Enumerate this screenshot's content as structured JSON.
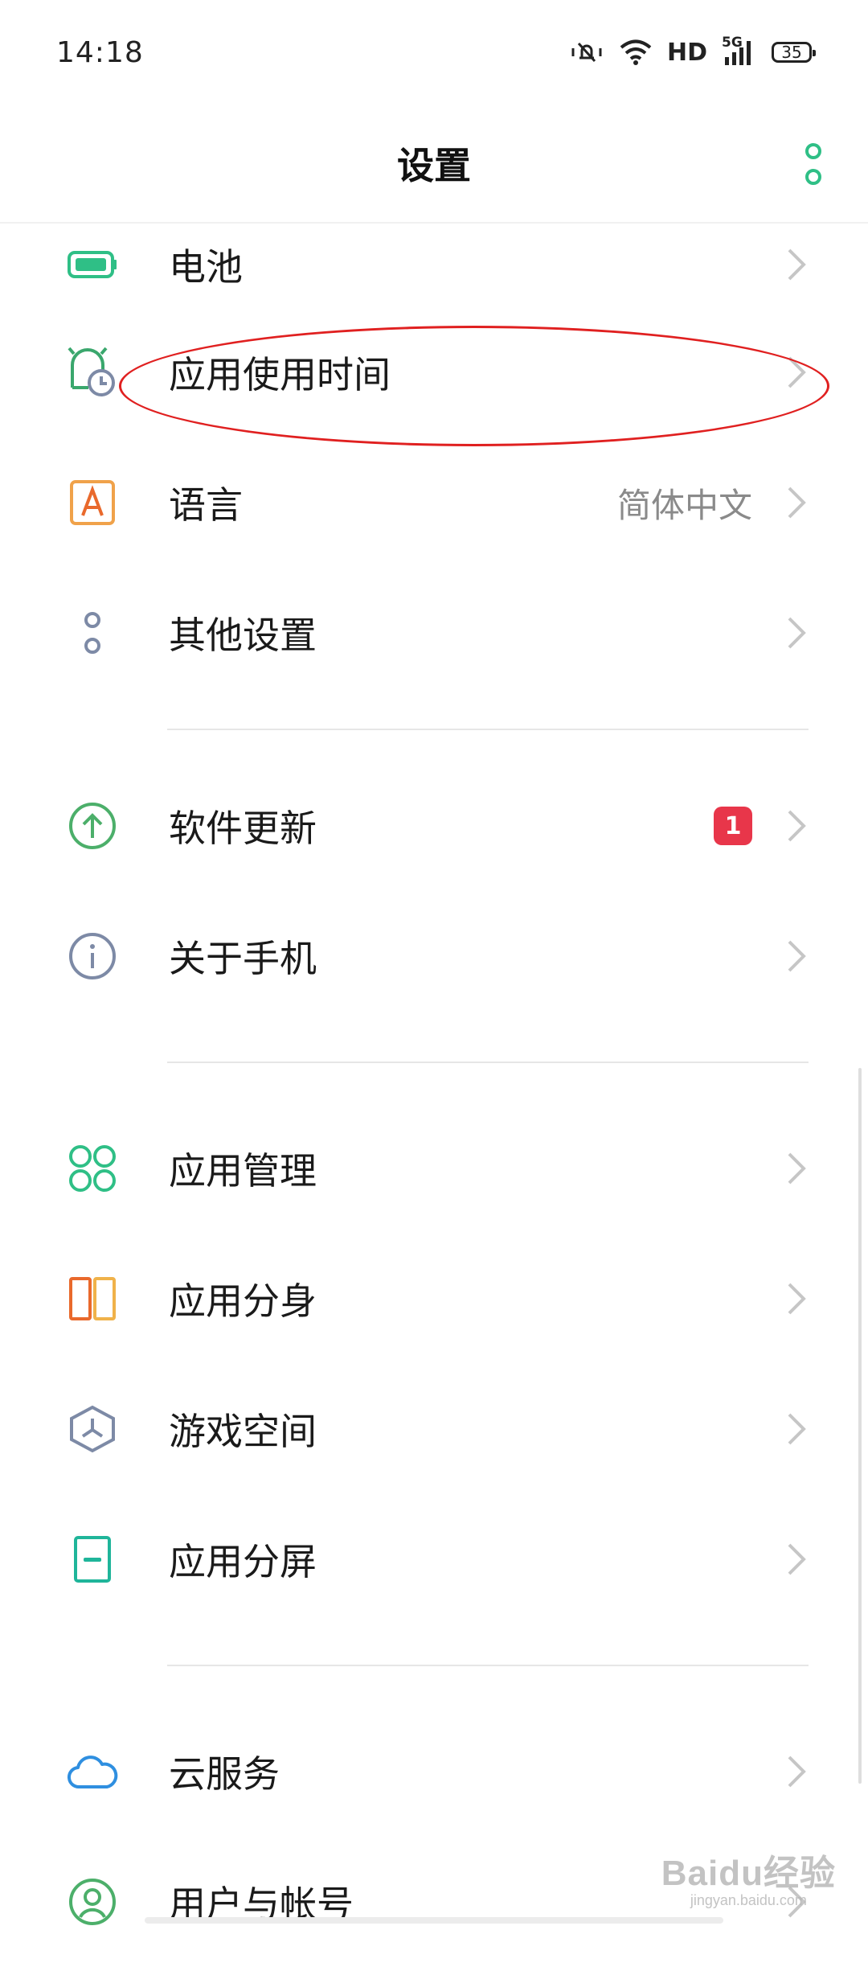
{
  "status_bar": {
    "time": "14:18",
    "network_label": "HD",
    "signal_label": "5G",
    "battery_level": "35",
    "icons": [
      "mute-vibrate-icon",
      "wifi-icon",
      "signal-icon",
      "battery-icon"
    ]
  },
  "header": {
    "title": "设置",
    "more_icon": "more-vertical-icon",
    "accent_color": "#2fbf86"
  },
  "groups": [
    {
      "items": [
        {
          "id": "battery",
          "label": "电池",
          "icon": "battery-icon",
          "icon_color": "#2fbf86"
        },
        {
          "id": "app-usage-time",
          "label": "应用使用时间",
          "icon": "alarm-clock-icon",
          "icon_color": "#3aa76d",
          "highlighted": true
        },
        {
          "id": "language",
          "label": "语言",
          "value": "简体中文",
          "icon": "language-icon",
          "icon_color": "#f0a24a"
        },
        {
          "id": "other-settings",
          "label": "其他设置",
          "icon": "dots-icon",
          "icon_color": "#7d8aa6"
        }
      ]
    },
    {
      "items": [
        {
          "id": "software-update",
          "label": "软件更新",
          "badge": "1",
          "icon": "upload-arrow-icon",
          "icon_color": "#4caf6a"
        },
        {
          "id": "about-phone",
          "label": "关于手机",
          "icon": "info-icon",
          "icon_color": "#7d8aa6"
        }
      ]
    },
    {
      "items": [
        {
          "id": "app-management",
          "label": "应用管理",
          "icon": "apps-grid-icon",
          "icon_color": "#2fbf86"
        },
        {
          "id": "app-clone",
          "label": "应用分身",
          "icon": "clone-icon",
          "icon_color": "#e9692c"
        },
        {
          "id": "game-space",
          "label": "游戏空间",
          "icon": "hexagon-icon",
          "icon_color": "#7d8aa6"
        },
        {
          "id": "split-screen",
          "label": "应用分屏",
          "icon": "split-screen-icon",
          "icon_color": "#1fb59a"
        }
      ]
    },
    {
      "items": [
        {
          "id": "cloud-service",
          "label": "云服务",
          "icon": "cloud-icon",
          "icon_color": "#2f8fe0"
        },
        {
          "id": "users-accounts",
          "label": "用户与帐号",
          "icon": "user-icon",
          "icon_color": "#4caf6a"
        }
      ]
    }
  ],
  "annotation_color": "#e02020",
  "badge_color": "#e8364a",
  "watermark": {
    "main": "Baidu经验",
    "sub": "jingyan.baidu.com"
  }
}
